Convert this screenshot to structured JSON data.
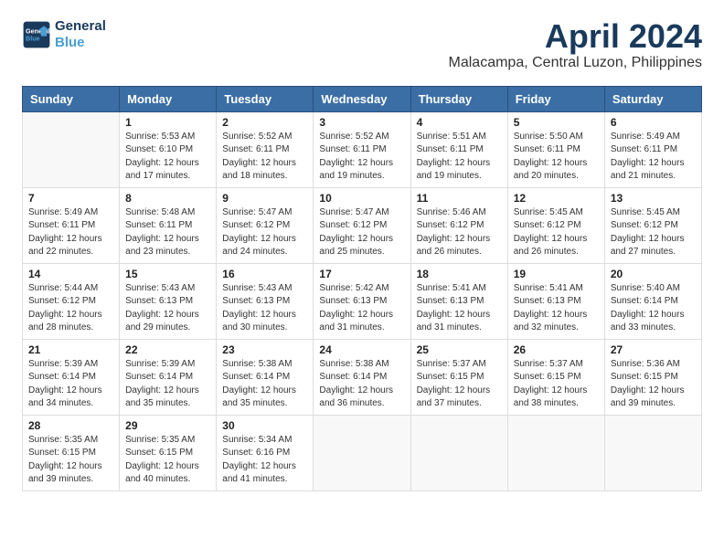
{
  "logo": {
    "line1": "General",
    "line2": "Blue"
  },
  "title": "April 2024",
  "location": "Malacampa, Central Luzon, Philippines",
  "weekdays": [
    "Sunday",
    "Monday",
    "Tuesday",
    "Wednesday",
    "Thursday",
    "Friday",
    "Saturday"
  ],
  "weeks": [
    [
      {
        "day": "",
        "empty": true
      },
      {
        "day": "1",
        "sunrise": "Sunrise: 5:53 AM",
        "sunset": "Sunset: 6:10 PM",
        "daylight": "Daylight: 12 hours and 17 minutes."
      },
      {
        "day": "2",
        "sunrise": "Sunrise: 5:52 AM",
        "sunset": "Sunset: 6:11 PM",
        "daylight": "Daylight: 12 hours and 18 minutes."
      },
      {
        "day": "3",
        "sunrise": "Sunrise: 5:52 AM",
        "sunset": "Sunset: 6:11 PM",
        "daylight": "Daylight: 12 hours and 19 minutes."
      },
      {
        "day": "4",
        "sunrise": "Sunrise: 5:51 AM",
        "sunset": "Sunset: 6:11 PM",
        "daylight": "Daylight: 12 hours and 19 minutes."
      },
      {
        "day": "5",
        "sunrise": "Sunrise: 5:50 AM",
        "sunset": "Sunset: 6:11 PM",
        "daylight": "Daylight: 12 hours and 20 minutes."
      },
      {
        "day": "6",
        "sunrise": "Sunrise: 5:49 AM",
        "sunset": "Sunset: 6:11 PM",
        "daylight": "Daylight: 12 hours and 21 minutes."
      }
    ],
    [
      {
        "day": "7",
        "sunrise": "Sunrise: 5:49 AM",
        "sunset": "Sunset: 6:11 PM",
        "daylight": "Daylight: 12 hours and 22 minutes."
      },
      {
        "day": "8",
        "sunrise": "Sunrise: 5:48 AM",
        "sunset": "Sunset: 6:11 PM",
        "daylight": "Daylight: 12 hours and 23 minutes."
      },
      {
        "day": "9",
        "sunrise": "Sunrise: 5:47 AM",
        "sunset": "Sunset: 6:12 PM",
        "daylight": "Daylight: 12 hours and 24 minutes."
      },
      {
        "day": "10",
        "sunrise": "Sunrise: 5:47 AM",
        "sunset": "Sunset: 6:12 PM",
        "daylight": "Daylight: 12 hours and 25 minutes."
      },
      {
        "day": "11",
        "sunrise": "Sunrise: 5:46 AM",
        "sunset": "Sunset: 6:12 PM",
        "daylight": "Daylight: 12 hours and 26 minutes."
      },
      {
        "day": "12",
        "sunrise": "Sunrise: 5:45 AM",
        "sunset": "Sunset: 6:12 PM",
        "daylight": "Daylight: 12 hours and 26 minutes."
      },
      {
        "day": "13",
        "sunrise": "Sunrise: 5:45 AM",
        "sunset": "Sunset: 6:12 PM",
        "daylight": "Daylight: 12 hours and 27 minutes."
      }
    ],
    [
      {
        "day": "14",
        "sunrise": "Sunrise: 5:44 AM",
        "sunset": "Sunset: 6:12 PM",
        "daylight": "Daylight: 12 hours and 28 minutes."
      },
      {
        "day": "15",
        "sunrise": "Sunrise: 5:43 AM",
        "sunset": "Sunset: 6:13 PM",
        "daylight": "Daylight: 12 hours and 29 minutes."
      },
      {
        "day": "16",
        "sunrise": "Sunrise: 5:43 AM",
        "sunset": "Sunset: 6:13 PM",
        "daylight": "Daylight: 12 hours and 30 minutes."
      },
      {
        "day": "17",
        "sunrise": "Sunrise: 5:42 AM",
        "sunset": "Sunset: 6:13 PM",
        "daylight": "Daylight: 12 hours and 31 minutes."
      },
      {
        "day": "18",
        "sunrise": "Sunrise: 5:41 AM",
        "sunset": "Sunset: 6:13 PM",
        "daylight": "Daylight: 12 hours and 31 minutes."
      },
      {
        "day": "19",
        "sunrise": "Sunrise: 5:41 AM",
        "sunset": "Sunset: 6:13 PM",
        "daylight": "Daylight: 12 hours and 32 minutes."
      },
      {
        "day": "20",
        "sunrise": "Sunrise: 5:40 AM",
        "sunset": "Sunset: 6:14 PM",
        "daylight": "Daylight: 12 hours and 33 minutes."
      }
    ],
    [
      {
        "day": "21",
        "sunrise": "Sunrise: 5:39 AM",
        "sunset": "Sunset: 6:14 PM",
        "daylight": "Daylight: 12 hours and 34 minutes."
      },
      {
        "day": "22",
        "sunrise": "Sunrise: 5:39 AM",
        "sunset": "Sunset: 6:14 PM",
        "daylight": "Daylight: 12 hours and 35 minutes."
      },
      {
        "day": "23",
        "sunrise": "Sunrise: 5:38 AM",
        "sunset": "Sunset: 6:14 PM",
        "daylight": "Daylight: 12 hours and 35 minutes."
      },
      {
        "day": "24",
        "sunrise": "Sunrise: 5:38 AM",
        "sunset": "Sunset: 6:14 PM",
        "daylight": "Daylight: 12 hours and 36 minutes."
      },
      {
        "day": "25",
        "sunrise": "Sunrise: 5:37 AM",
        "sunset": "Sunset: 6:15 PM",
        "daylight": "Daylight: 12 hours and 37 minutes."
      },
      {
        "day": "26",
        "sunrise": "Sunrise: 5:37 AM",
        "sunset": "Sunset: 6:15 PM",
        "daylight": "Daylight: 12 hours and 38 minutes."
      },
      {
        "day": "27",
        "sunrise": "Sunrise: 5:36 AM",
        "sunset": "Sunset: 6:15 PM",
        "daylight": "Daylight: 12 hours and 39 minutes."
      }
    ],
    [
      {
        "day": "28",
        "sunrise": "Sunrise: 5:35 AM",
        "sunset": "Sunset: 6:15 PM",
        "daylight": "Daylight: 12 hours and 39 minutes."
      },
      {
        "day": "29",
        "sunrise": "Sunrise: 5:35 AM",
        "sunset": "Sunset: 6:15 PM",
        "daylight": "Daylight: 12 hours and 40 minutes."
      },
      {
        "day": "30",
        "sunrise": "Sunrise: 5:34 AM",
        "sunset": "Sunset: 6:16 PM",
        "daylight": "Daylight: 12 hours and 41 minutes."
      },
      {
        "day": "",
        "empty": true
      },
      {
        "day": "",
        "empty": true
      },
      {
        "day": "",
        "empty": true
      },
      {
        "day": "",
        "empty": true
      }
    ]
  ]
}
